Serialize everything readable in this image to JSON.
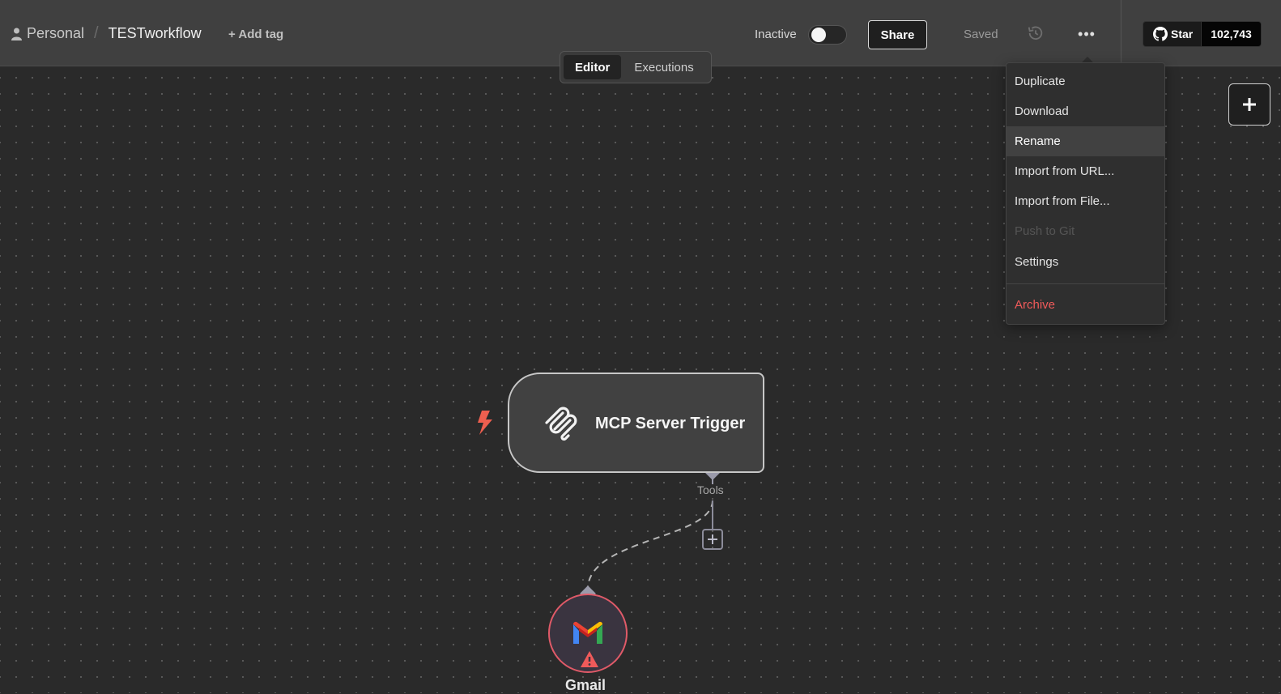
{
  "header": {
    "project": "Personal",
    "workflow_title": "TESTworkflow",
    "add_tag": "+ Add tag",
    "status_label": "Inactive",
    "share_label": "Share",
    "saved_label": "Saved",
    "more_label": "•••",
    "github": {
      "star_label": "Star",
      "star_count": "102,743"
    }
  },
  "tabs": [
    {
      "label": "Editor",
      "active": true
    },
    {
      "label": "Executions",
      "active": false
    }
  ],
  "menu": {
    "items": [
      {
        "label": "Duplicate"
      },
      {
        "label": "Download"
      },
      {
        "label": "Rename",
        "highlighted": true
      },
      {
        "label": "Import from URL..."
      },
      {
        "label": "Import from File..."
      },
      {
        "label": "Push to Git",
        "disabled": true
      },
      {
        "label": "Settings"
      },
      {
        "label": "Archive",
        "danger": true
      }
    ]
  },
  "canvas": {
    "trigger_node": {
      "label": "MCP Server Trigger",
      "icon": "mcp-icon"
    },
    "connection_label": "Tools",
    "tool_node": {
      "label": "Gmail",
      "icon": "gmail-icon",
      "has_warning": true
    }
  },
  "colors": {
    "accent_danger": "#f05a5a",
    "node_border_error": "#e05a68",
    "canvas_bg": "#2a2a2a",
    "trigger_bolt": "#ee5f4f"
  }
}
